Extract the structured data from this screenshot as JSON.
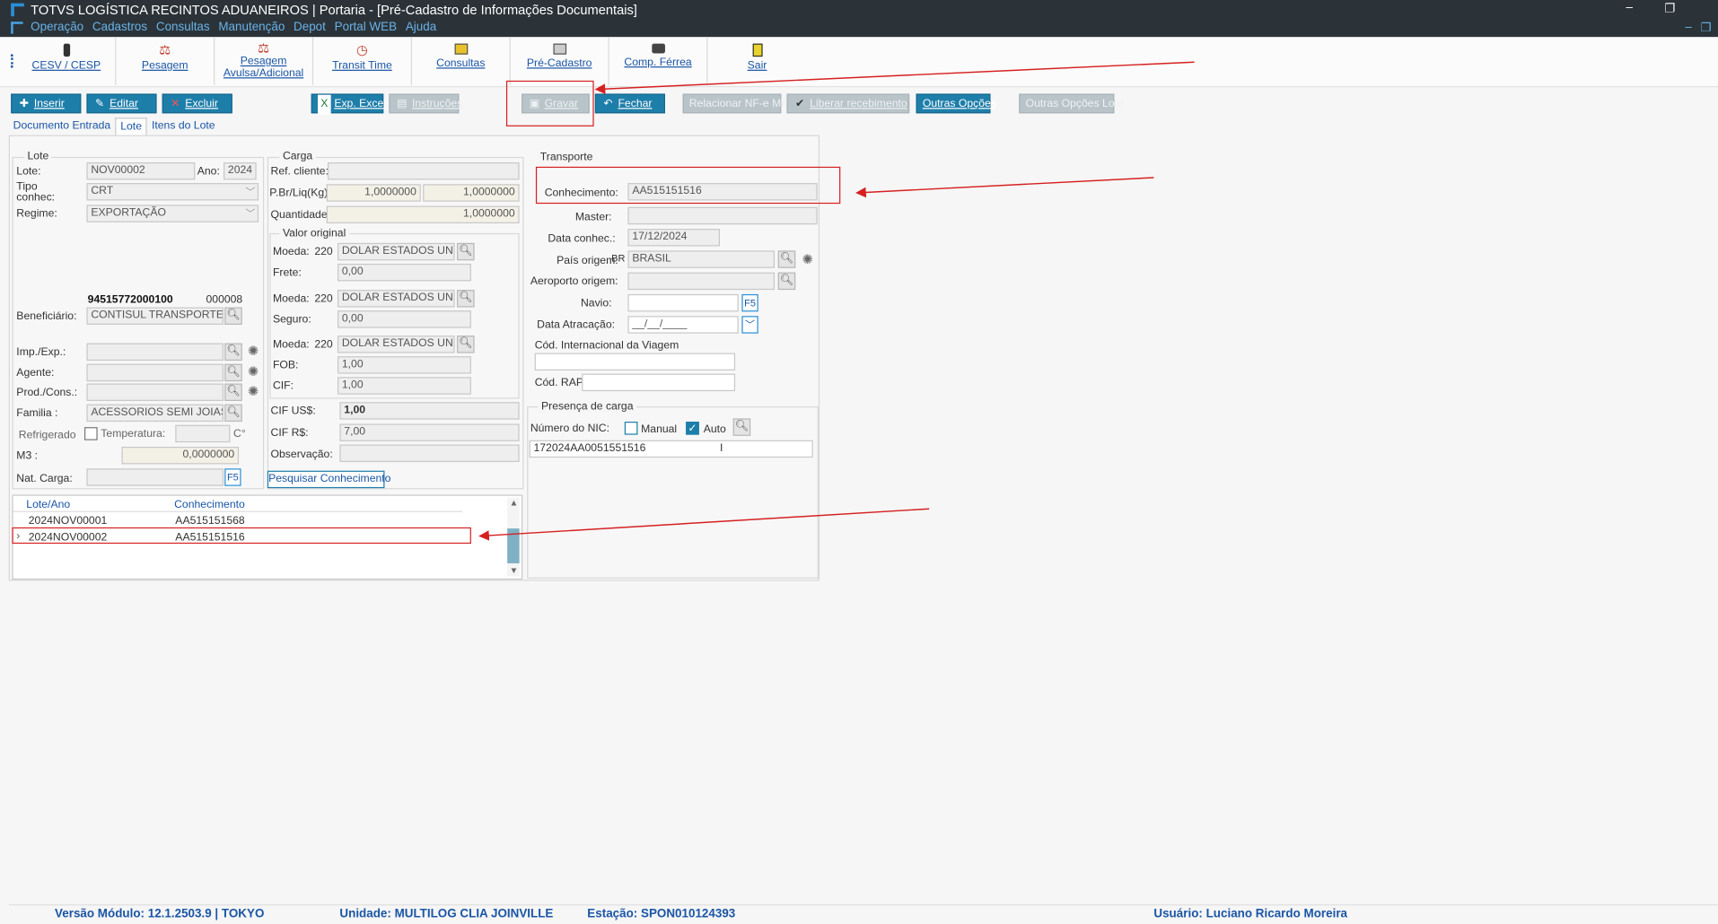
{
  "window": {
    "title": "TOTVS LOGÍSTICA RECINTOS ADUANEIROS | Portaria - [Pré-Cadastro de Informações Documentais]",
    "menu": [
      "Operação",
      "Cadastros",
      "Consultas",
      "Manutenção",
      "Depot",
      "Portal WEB",
      "Ajuda"
    ],
    "minimize": "–",
    "restore": "❐",
    "inner_minimize": "–",
    "inner_restore": "❐"
  },
  "toolbar": {
    "items": [
      {
        "label": "CESV / CESP",
        "icon": "traffic-light-icon"
      },
      {
        "label": "Pesagem",
        "icon": "scale-icon"
      },
      {
        "label": "Pesagem Avulsa/Adicional",
        "icon": "scale-icon"
      },
      {
        "label": "Transit Time",
        "icon": "clock-icon"
      },
      {
        "label": "Consultas",
        "icon": "printer-icon"
      },
      {
        "label": "Pré-Cadastro",
        "icon": "printer-icon"
      },
      {
        "label": "Comp. Férrea",
        "icon": "train-icon"
      },
      {
        "label": "Sair",
        "icon": "exit-door-icon"
      }
    ]
  },
  "actions": {
    "inserir": "Inserir",
    "editar": "Editar",
    "excluir": "Excluir",
    "exp_excel": "Exp. Excel",
    "instrucoes": "Instruções",
    "gravar": "Gravar",
    "fechar": "Fechar",
    "relacionar": "Relacionar NF-e Mãe",
    "liberar": "Liberar recebimento",
    "outras": "Outras Opções",
    "outras_lote": "Outras Opções Lote"
  },
  "tabs": [
    "Documento Entrada",
    "Lote",
    "Itens do Lote"
  ],
  "lote": {
    "group_title": "Lote",
    "lote_label": "Lote:",
    "lote_value": "NOV00002",
    "ano_label": "Ano:",
    "ano_value": "2024",
    "tipo_label": "Tipo conhec:",
    "tipo_value": "CRT",
    "regime_label": "Regime:",
    "regime_value": "EXPORTAÇÃO",
    "cnpj": "94515772000100",
    "cnpj_code": "000008",
    "beneficiario_label": "Beneficiário:",
    "beneficiario_value": "CONTISUL TRANSPORTES LTD.",
    "imp_label": "Imp./Exp.:",
    "agente_label": "Agente:",
    "prod_label": "Prod./Cons.:",
    "familia_label": "Familia :",
    "familia_value": "ACESSORIOS SEMI JOIAS",
    "refrig_label": "Refrigerado",
    "temp_label": "Temperatura:",
    "temp_unit": "C°",
    "m3_label": "M3  :",
    "m3_value": "0,0000000",
    "nat_label": "Nat. Carga:",
    "f5": "F5"
  },
  "carga": {
    "group_title": "Carga",
    "ref_label": "Ref. cliente:",
    "pbr_label": "P.Br/Liq(Kg):",
    "pbr_value": "1,0000000",
    "pliq_value": "1,0000000",
    "qtd_label": "Quantidade:",
    "qtd_value": "1,0000000",
    "valor_title": "Valor original",
    "moeda_label": "Moeda:",
    "moeda_code": "220",
    "moeda_name": "DOLAR ESTADOS UNIDOS",
    "frete_label": "Frete:",
    "frete_value": "0,00",
    "seguro_label": "Seguro:",
    "seguro_value": "0,00",
    "fob_label": "FOB:",
    "fob_value": "1,00",
    "cif_label": "CIF:",
    "cif_value": "1,00",
    "cif_us_label": "CIF  US$:",
    "cif_us_value": "1,00",
    "cif_rs_label": "CIF  R$:",
    "cif_rs_value": "7,00",
    "obs_label": "Observação:",
    "pesquisar": "Pesquisar Conhecimento"
  },
  "transporte": {
    "group_title": "Transporte",
    "conhecimento_label": "Conhecimento:",
    "conhecimento_value": "AA515151516",
    "master_label": "Master:",
    "data_label": "Data conhec.:",
    "data_value": "17/12/2024",
    "pais_label": "País origem:",
    "pais_code": "BR",
    "pais_value": "BRASIL",
    "aeroporto_label": "Aeroporto origem:",
    "navio_label": "Navio:",
    "atracacao_label": "Data Atracação:",
    "atracacao_value": "__/__/____",
    "cod_int_label": "Cód. Internacional da Viagem",
    "cod_rap_label": "Cód. RAP",
    "f5": "F5"
  },
  "presenca": {
    "group_title": "Presença de carga",
    "nic_label": "Número do NIC:",
    "manual_label": "Manual",
    "auto_label": "Auto",
    "nic_value": "172024AA0051551516",
    "cursor": "I"
  },
  "grid": {
    "columns": [
      "Lote/Ano",
      "Conhecimento"
    ],
    "rows": [
      {
        "lote": "2024NOV00001",
        "conhecimento": "AA515151568"
      },
      {
        "lote": "2024NOV00002",
        "conhecimento": "AA515151516"
      }
    ]
  },
  "status": {
    "versao": "Versão Módulo:  12.1.2503.9  |  TOKYO",
    "unidade": "Unidade:  MULTILOG CLIA JOINVILLE",
    "estacao": "Estação:  SPON010124393",
    "usuario": "Usuário:  Luciano Ricardo Moreira"
  },
  "colors": {
    "accent": "#1e7eaa",
    "titlebar": "#2b3338",
    "annotation": "#d62020"
  }
}
